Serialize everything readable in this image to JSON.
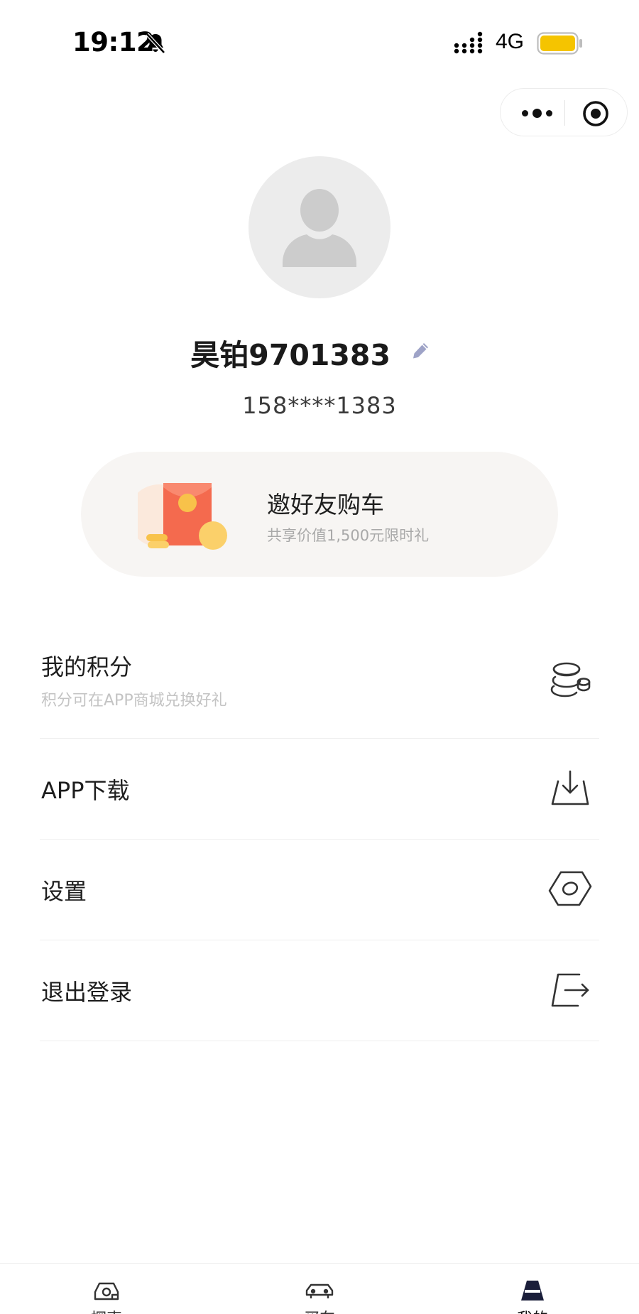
{
  "status_bar": {
    "time": "19:12",
    "network": "4G",
    "battery_color": "#f5c400"
  },
  "capsule": {
    "more_icon": "more-dots-icon",
    "close_icon": "target-close-icon"
  },
  "profile": {
    "avatar_icon": "default-avatar-icon",
    "name": "昊铂9701383",
    "phone": "158****1383"
  },
  "invite": {
    "title": "邀好友购车",
    "subtitle": "共享价值1,500元限时礼",
    "accent": "#f26a4a"
  },
  "menu": {
    "points": {
      "title": "我的积分",
      "subtitle": "积分可在APP商城兑换好礼",
      "icon": "coins-icon"
    },
    "download": {
      "title": "APP下载",
      "icon": "download-icon"
    },
    "settings": {
      "title": "设置",
      "icon": "hexagon-settings-icon"
    },
    "logout": {
      "title": "退出登录",
      "icon": "logout-icon"
    }
  },
  "bottom_nav": {
    "items": [
      {
        "label": "探索",
        "icon": "explore-icon"
      },
      {
        "label": "买车",
        "icon": "car-icon"
      },
      {
        "label": "我的",
        "icon": "profile-tab-icon",
        "active": true
      }
    ]
  }
}
